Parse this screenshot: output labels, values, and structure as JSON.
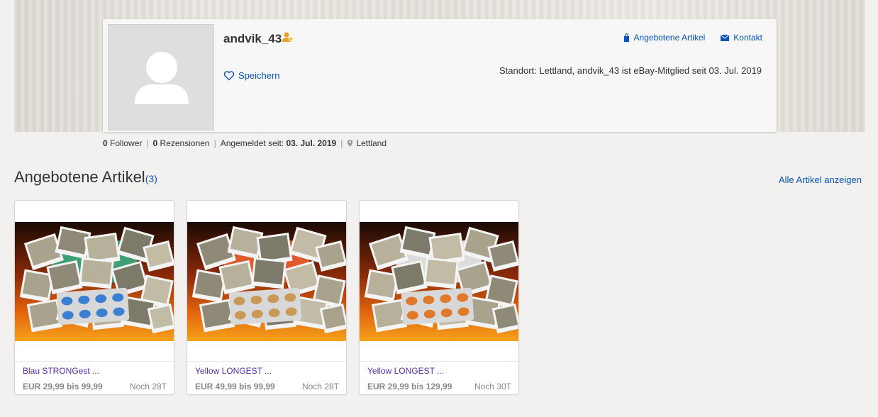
{
  "profile": {
    "username": "andvik_43",
    "save_label": "Speichern",
    "links": {
      "offered_items": "Angebotene Artikel",
      "contact": "Kontakt"
    },
    "location_text": "Standort: Lettland, andvik_43 ist eBay-Mitglied seit 03. Jul. 2019"
  },
  "stats": {
    "followers_count": "0",
    "followers_label": "Follower",
    "reviews_count": "0",
    "reviews_label": "Rezensionen",
    "member_since_label": "Angemeldet seit:",
    "member_since_date": "03. Jul. 2019",
    "location": "Lettland"
  },
  "section": {
    "title": "Angebotene Artikel",
    "count": "(3)",
    "view_all": "Alle Artikel anzeigen"
  },
  "items": [
    {
      "title": "Blau STRONGest ...",
      "price": "EUR 29,99 bis 99,99",
      "time_left": "Noch 28T",
      "pill_color": "#3a7fd0",
      "box_color": "#3e9e74"
    },
    {
      "title": "Yellow LONGEST ...",
      "price": "EUR 49,99 bis 99,99",
      "time_left": "Noch 28T",
      "pill_color": "#c89a55",
      "box_color": "#e0592a"
    },
    {
      "title": "Yellow LONGEST ...",
      "price": "EUR 29,99 bis 129,99",
      "time_left": "Noch 30T",
      "pill_color": "#e07a2a",
      "box_color": "#dcdcdc"
    }
  ],
  "colors": {
    "link_blue": "#0654ba",
    "item_title_purple": "#5a2ea6",
    "badge_gold": "#e8a22c"
  }
}
